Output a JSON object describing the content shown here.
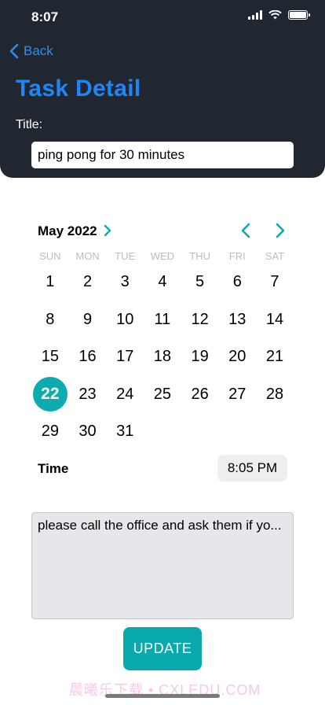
{
  "status_bar": {
    "time": "8:07"
  },
  "nav": {
    "back_label": "Back"
  },
  "page": {
    "title": "Task Detail",
    "title_field_label": "Title:"
  },
  "task": {
    "title_value": "ping pong for 30 minutes",
    "notes": "please call the office and ask them if yo..."
  },
  "calendar": {
    "month_label": "May 2022",
    "weekdays": [
      "SUN",
      "MON",
      "TUE",
      "WED",
      "THU",
      "FRI",
      "SAT"
    ],
    "days": [
      "1",
      "2",
      "3",
      "4",
      "5",
      "6",
      "7",
      "8",
      "9",
      "10",
      "11",
      "12",
      "13",
      "14",
      "15",
      "16",
      "17",
      "18",
      "19",
      "20",
      "21",
      "22",
      "23",
      "24",
      "25",
      "26",
      "27",
      "28",
      "29",
      "30",
      "31"
    ],
    "selected_day": "22",
    "accent_color": "#0cabb0"
  },
  "time": {
    "label": "Time",
    "value": "8:05 PM"
  },
  "actions": {
    "update_label": "UPDATE"
  },
  "watermark": {
    "text": "晨曦乐下载 • CXLEDU.COM"
  }
}
